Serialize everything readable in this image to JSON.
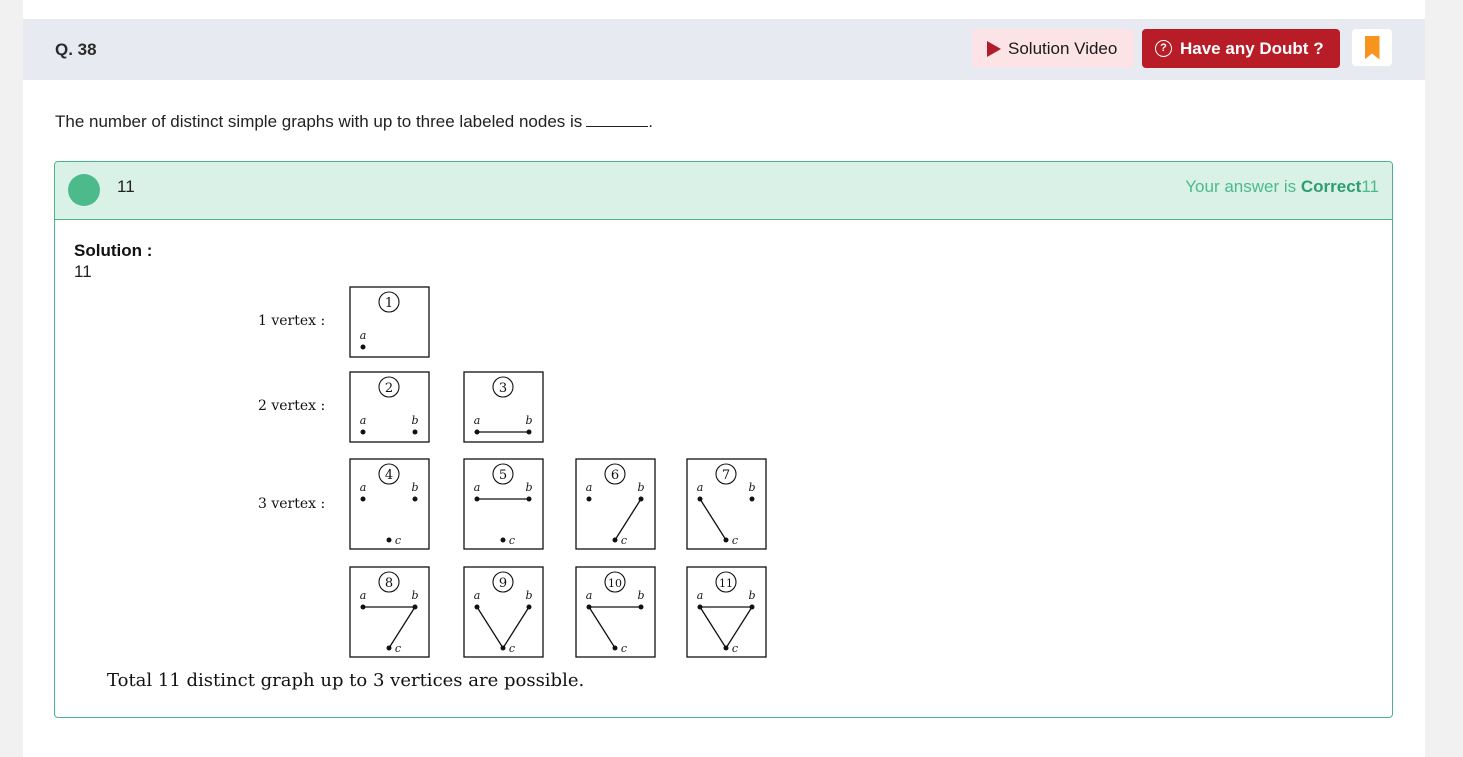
{
  "header": {
    "question_number": "Q. 38",
    "solution_video_label": "Solution Video",
    "doubt_label": "Have any Doubt ?"
  },
  "question": {
    "text": "The number of distinct simple graphs with up to three labeled nodes is"
  },
  "answer": {
    "user_value": "11",
    "verdict_prefix": "Your answer is ",
    "verdict_status": "Correct",
    "correct_value": "11"
  },
  "solution": {
    "title": "Solution :",
    "value": "11",
    "row_labels": [
      "1 vertex :",
      "2 vertex :",
      "3 vertex :"
    ],
    "vertex_labels": [
      "a",
      "b",
      "c"
    ],
    "graphs": [
      {
        "number": "1",
        "vertices": [
          "a"
        ],
        "edges": []
      },
      {
        "number": "2",
        "vertices": [
          "a",
          "b"
        ],
        "edges": []
      },
      {
        "number": "3",
        "vertices": [
          "a",
          "b"
        ],
        "edges": [
          [
            "a",
            "b"
          ]
        ]
      },
      {
        "number": "4",
        "vertices": [
          "a",
          "b",
          "c"
        ],
        "edges": []
      },
      {
        "number": "5",
        "vertices": [
          "a",
          "b",
          "c"
        ],
        "edges": [
          [
            "a",
            "b"
          ]
        ]
      },
      {
        "number": "6",
        "vertices": [
          "a",
          "b",
          "c"
        ],
        "edges": [
          [
            "b",
            "c"
          ]
        ]
      },
      {
        "number": "7",
        "vertices": [
          "a",
          "b",
          "c"
        ],
        "edges": [
          [
            "a",
            "c"
          ]
        ]
      },
      {
        "number": "8",
        "vertices": [
          "a",
          "b",
          "c"
        ],
        "edges": [
          [
            "a",
            "b"
          ],
          [
            "b",
            "c"
          ]
        ]
      },
      {
        "number": "9",
        "vertices": [
          "a",
          "b",
          "c"
        ],
        "edges": [
          [
            "a",
            "c"
          ],
          [
            "b",
            "c"
          ]
        ]
      },
      {
        "number": "10",
        "vertices": [
          "a",
          "b",
          "c"
        ],
        "edges": [
          [
            "a",
            "b"
          ],
          [
            "a",
            "c"
          ]
        ]
      },
      {
        "number": "11",
        "vertices": [
          "a",
          "b",
          "c"
        ],
        "edges": [
          [
            "a",
            "b"
          ],
          [
            "b",
            "c"
          ],
          [
            "a",
            "c"
          ]
        ]
      }
    ],
    "caption": "Total 11 distinct graph up to 3 vertices are possible."
  },
  "colors": {
    "correct_green": "#4dba8b",
    "doubt_red": "#b71c27",
    "bookmark_orange": "#f7941d"
  },
  "icons": [
    "play-icon",
    "doubt-icon",
    "bookmark-icon"
  ]
}
